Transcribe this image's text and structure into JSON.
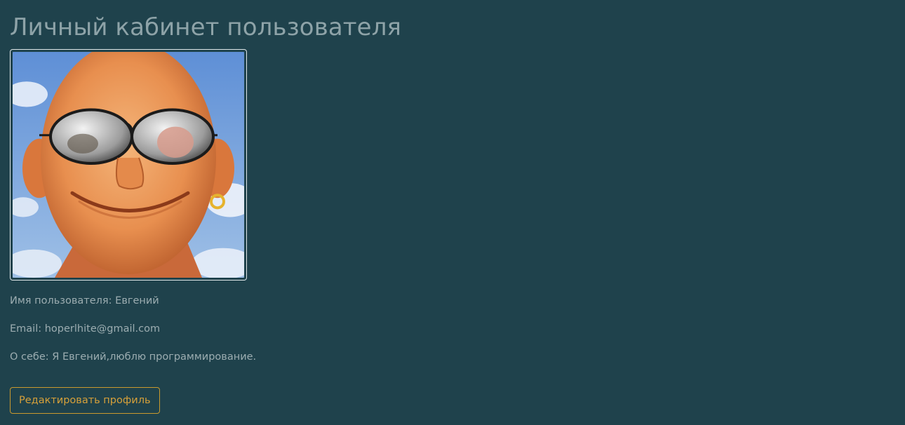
{
  "page": {
    "title": "Личный кабинет пользователя"
  },
  "profile": {
    "avatar_icon": "user-avatar-image",
    "name_label": "Имя пользователя: ",
    "name_value": "Евгений",
    "email_label": "Email: ",
    "email_value": "hoperlhite@gmail.com",
    "about_label": "О себе: ",
    "about_value": "Я Евгений,люблю программирование."
  },
  "actions": {
    "edit_label": "Редактировать профиль"
  },
  "colors": {
    "background": "#1f424c",
    "text": "#9cadb1",
    "accent": "#c99a2e"
  }
}
